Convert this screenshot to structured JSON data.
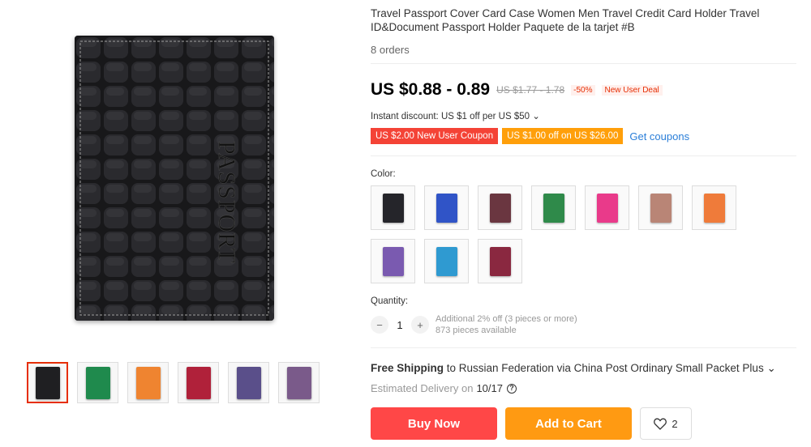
{
  "product": {
    "title": "Travel Passport Cover Card Case Women Men Travel Credit Card Holder Travel ID&Document Passport Holder Paquete de la tarjet #B",
    "orders": "8 orders",
    "image_text": "PASSPORT"
  },
  "price": {
    "current": "US $0.88 - 0.89",
    "original": "US $1.77 - 1.78",
    "discount": "-50%",
    "deal": "New User Deal"
  },
  "instant_discount": "Instant discount: US $1 off per US $50 ⌄",
  "coupons": {
    "new_user": "US $2.00 New User Coupon",
    "off": "US $1.00 off on US $26.00",
    "link": "Get coupons"
  },
  "color": {
    "label": "Color:",
    "options": [
      "#25252a",
      "#3054c7",
      "#6a3640",
      "#2f8a4a",
      "#e93a8a",
      "#b98576",
      "#ef7b3a",
      "#7a5ab0",
      "#2f9ad1",
      "#8a2840"
    ]
  },
  "thumbs": [
    "#1f1f22",
    "#1f8a4d",
    "#ef8430",
    "#b0213a",
    "#5a4f8a",
    "#7a5a8a"
  ],
  "quantity": {
    "label": "Quantity:",
    "value": "1",
    "note1": "Additional 2% off (3 pieces or more)",
    "note2": "873 pieces available"
  },
  "shipping": {
    "free": "Free Shipping",
    "text": " to Russian Federation via China Post Ordinary Small Packet Plus ⌄",
    "estimated": "Estimated Delivery on",
    "date": "10/17"
  },
  "buttons": {
    "buy": "Buy Now",
    "cart": "Add to Cart",
    "wish_count": "2"
  },
  "icons": {
    "help": "help-icon",
    "heart": "heart-icon",
    "minus": "minus-icon",
    "plus": "plus-icon"
  }
}
